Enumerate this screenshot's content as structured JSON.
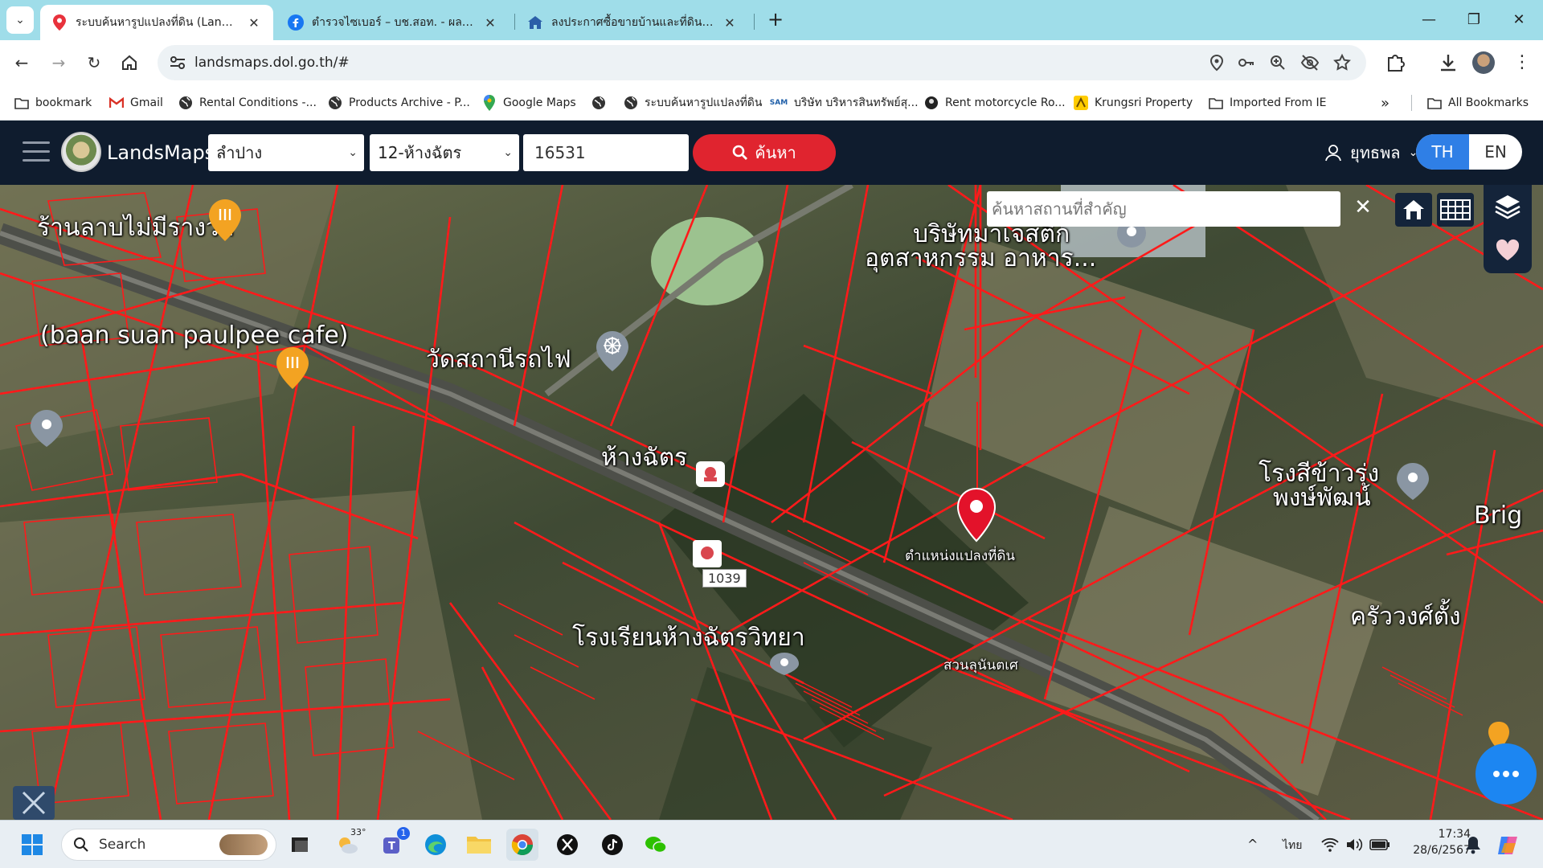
{
  "browser": {
    "tabs": [
      {
        "title": "ระบบค้นหารูปแปลงที่ดิน (LandsMaps)",
        "icon": "map-pin-icon",
        "active": true
      },
      {
        "title": "ตำรวจไซเบอร์ – บช.สอท. - ผลการค้นหา",
        "icon": "facebook-icon",
        "active": false
      },
      {
        "title": "ลงประกาศซื้อขายบ้านและที่ดินฟรี! | ที่ดิน",
        "icon": "house-icon",
        "active": false
      }
    ],
    "new_tab": "+",
    "window_controls": {
      "minimize": "—",
      "restore": "❐",
      "close": "✕"
    },
    "url": "landsmaps.dol.go.th/#",
    "bookmarks": [
      {
        "label": "bookmark",
        "icon": "folder-icon"
      },
      {
        "label": "Gmail",
        "icon": "gmail-icon"
      },
      {
        "label": "Rental Conditions -...",
        "icon": "globe-icon"
      },
      {
        "label": "Products Archive - P...",
        "icon": "globe-icon"
      },
      {
        "label": "Google Maps",
        "icon": "google-maps-icon"
      },
      {
        "label": "",
        "icon": "globe-icon"
      },
      {
        "label": "ระบบค้นหารูปแปลงที่ดิน",
        "icon": "globe-icon"
      },
      {
        "label": "บริษัท บริหารสินทรัพย์สุ...",
        "icon": "sam-icon"
      },
      {
        "label": "Rent motorcycle Ro...",
        "icon": "moto-icon"
      },
      {
        "label": "Krungsri Property",
        "icon": "krungsri-icon"
      },
      {
        "label": "Imported From IE",
        "icon": "folder-icon"
      }
    ],
    "bookmarks_overflow": "»",
    "all_bookmarks": "All Bookmarks"
  },
  "app": {
    "brand": "LandsMaps",
    "province": "ลำปาง",
    "district": "12-ห้างฉัตร",
    "parcel_number": "16531",
    "search_label": "ค้นหา",
    "user_name": "ยุทธพล",
    "lang_th": "TH",
    "lang_en": "EN"
  },
  "map": {
    "place_search_placeholder": "ค้นหาสถานที่สำคัญ",
    "clear_label": "✕",
    "labels": {
      "shop": "ร้านลาบไม่มีรางวัล",
      "cafe": "(baan suan paulpee cafe)",
      "temple": "วัดสถานีรถไฟ",
      "company": "บริษัทมาเจสติก",
      "industry": "อุตสาหกรรม อาหาร...",
      "hangchat": "ห้างฉัตร",
      "parcel_marker": "ตำแหน่งแปลงที่ดิน",
      "rice_mill": "โรงสีข้าวรุ่ง",
      "rice_mill_2": "พงษ์พัฒน์",
      "brig": "Brig",
      "school": "โรงเรียนห้างฉัตรวิทยา",
      "kitchen": "ครัววงศ์ตั้ง",
      "road_no": "1039",
      "garden": "สวนลุนันตเศ"
    }
  },
  "taskbar": {
    "search_label": "Search",
    "weather_temp": "33°",
    "teams_badge": "1",
    "lang": "ไทย",
    "time": "17:34",
    "date": "28/6/2567"
  }
}
